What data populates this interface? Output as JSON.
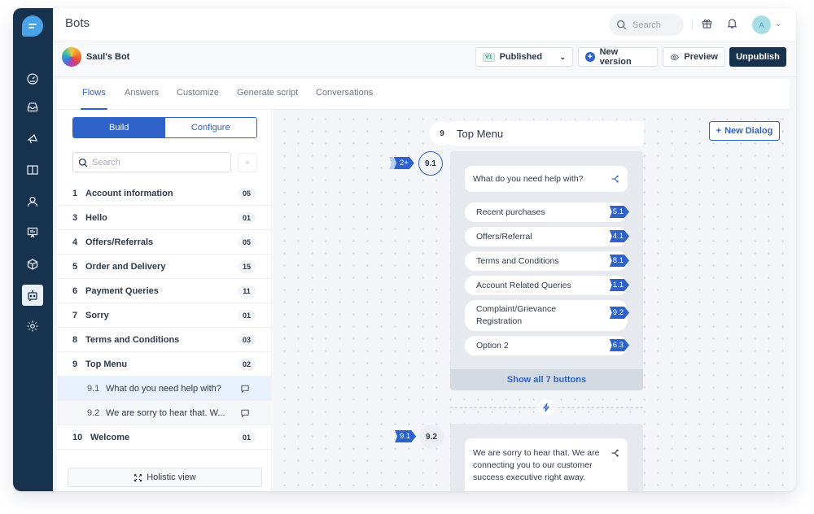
{
  "topbar": {
    "title": "Bots",
    "search_placeholder": "Search",
    "avatar_initial": "A"
  },
  "bot": {
    "name": "Saul's Bot",
    "version_tag": "V1",
    "version_status": "Published",
    "new_version_label": "New version",
    "preview_label": "Preview",
    "unpublish_label": "Unpublish"
  },
  "rail": {
    "items": [
      "dashboard",
      "inbox",
      "campaigns",
      "knowledge-base",
      "contacts",
      "analytics",
      "integrations",
      "bots",
      "settings"
    ],
    "active": "bots"
  },
  "tabs": [
    {
      "label": "Flows",
      "active": true
    },
    {
      "label": "Answers",
      "active": false
    },
    {
      "label": "Customize",
      "active": false
    },
    {
      "label": "Generate script",
      "active": false
    },
    {
      "label": "Conversations",
      "active": false
    }
  ],
  "left": {
    "segment": {
      "build": "Build",
      "configure": "Configure",
      "active": "build"
    },
    "search_placeholder": "Search",
    "add_label": "+",
    "flows": [
      {
        "num": "1",
        "name": "Account information",
        "count": "05"
      },
      {
        "num": "3",
        "name": "Hello",
        "count": "01"
      },
      {
        "num": "4",
        "name": "Offers/Referrals",
        "count": "05"
      },
      {
        "num": "5",
        "name": "Order and Delivery",
        "count": "15"
      },
      {
        "num": "6",
        "name": "Payment Queries",
        "count": "11"
      },
      {
        "num": "7",
        "name": "Sorry",
        "count": "01"
      },
      {
        "num": "8",
        "name": "Terms and Conditions",
        "count": "03"
      },
      {
        "num": "9",
        "name": "Top Menu",
        "count": "02"
      }
    ],
    "subflows": [
      {
        "num": "9.1",
        "name": "What do you need help with?",
        "selected": true
      },
      {
        "num": "9.2",
        "name": "We are sorry to hear that. W...",
        "selected": false
      }
    ],
    "last_flow": {
      "num": "10",
      "name": "Welcome",
      "count": "01"
    },
    "holistic_label": "Holistic view"
  },
  "canvas": {
    "flow_num": "9",
    "flow_title": "Top Menu",
    "new_dialog_label": "New Dialog",
    "dialog1": {
      "incoming_tag": "2+",
      "num": "9.1",
      "message": "What do you need help with?",
      "buttons": [
        {
          "label": "Recent purchases",
          "target": "5.1"
        },
        {
          "label": "Offers/Referral",
          "target": "4.1"
        },
        {
          "label": "Terms and Conditions",
          "target": "8.1"
        },
        {
          "label": "Account Related Queries",
          "target": "1.1"
        },
        {
          "label": "Complaint/Grievance Registration",
          "target": "9.2"
        },
        {
          "label": "Option 2",
          "target": "6.3"
        }
      ],
      "show_all_label": "Show all 7 buttons"
    },
    "dialog2": {
      "incoming_tag": "9.1",
      "num": "9.2",
      "message": "We are sorry to hear that. We are connecting you to our customer success executive right away."
    }
  }
}
